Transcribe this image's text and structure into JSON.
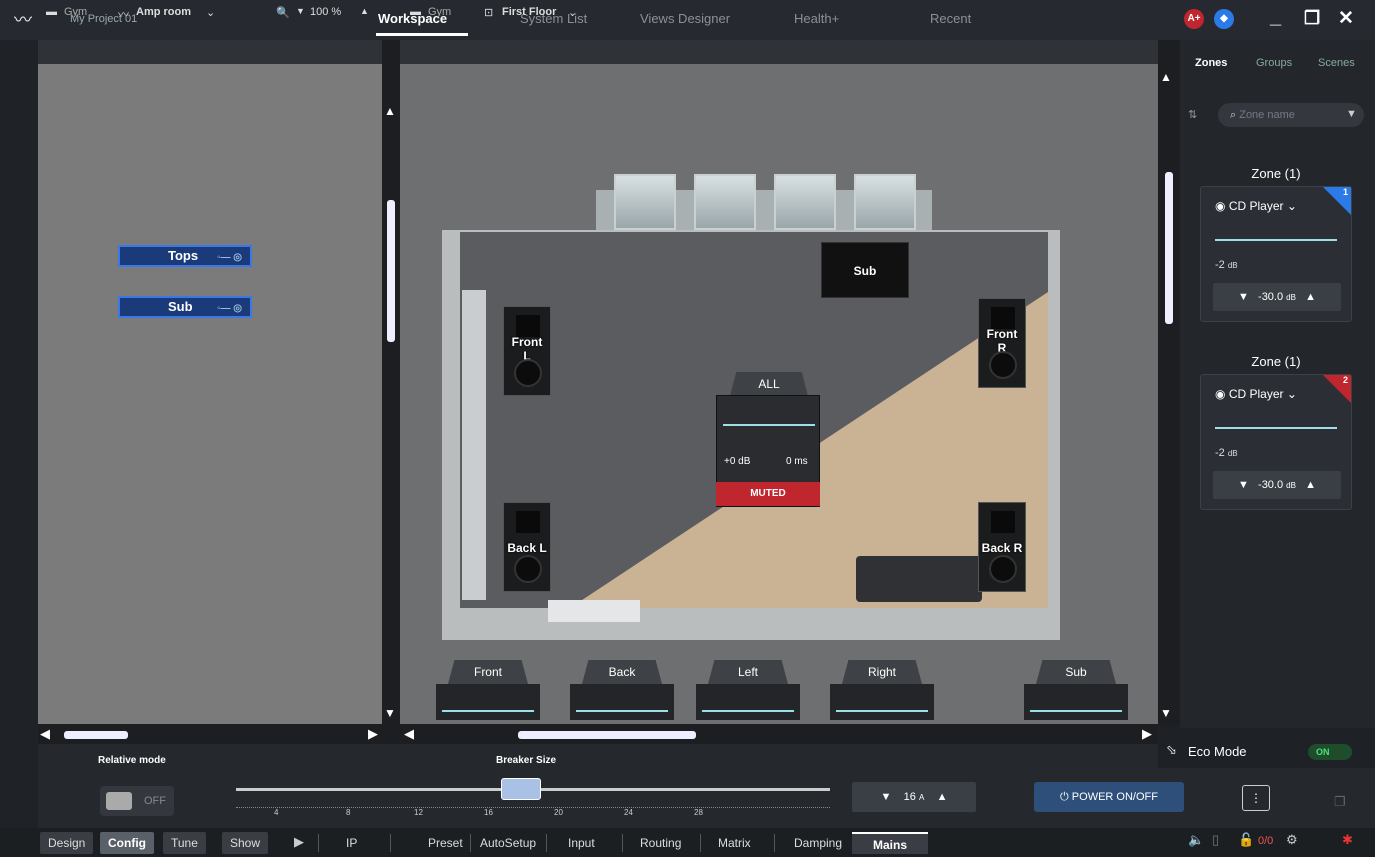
{
  "topbar": {
    "project": "My Project 01",
    "tabs": [
      "Workspace",
      "System List",
      "Views Designer",
      "Health+",
      "Recent"
    ],
    "active_tab": "Workspace",
    "badge_a": "A+",
    "badge_b": "◆",
    "minimize": "_",
    "restore": "❐",
    "close": "✕"
  },
  "left_panel": {
    "crumb_root": "Gym",
    "crumb_view": "Amp room",
    "zoom": "100 %",
    "amps": [
      {
        "label": "Tops"
      },
      {
        "label": "Sub"
      }
    ]
  },
  "floor_panel": {
    "crumb_root": "Gym",
    "crumb_view": "First Floor",
    "speakers": {
      "front_l": "Front\nL",
      "front_r": "Front\nR",
      "back_l": "Back L",
      "back_r": "Back R",
      "sub": "Sub"
    },
    "all": {
      "title": "ALL",
      "gain": "+0 dB",
      "delay": "0 ms",
      "muted": "MUTED"
    },
    "groups": [
      "Front",
      "Back",
      "Left",
      "Right",
      "Sub"
    ]
  },
  "right_panel": {
    "tabs": [
      "Zones",
      "Groups",
      "Scenes"
    ],
    "active": "Zones",
    "search_placeholder": "Zone name",
    "zones": [
      {
        "title": "Zone (1)",
        "source": "CD Player",
        "level": "-2",
        "level_unit": "dB",
        "step": "-30.0",
        "step_unit": "dB",
        "number": "1",
        "color": "#2a7ae8"
      },
      {
        "title": "Zone (1)",
        "source": "CD Player",
        "level": "-2",
        "level_unit": "dB",
        "step": "-30.0",
        "step_unit": "dB",
        "number": "2",
        "color": "#c0262d"
      }
    ]
  },
  "eco": {
    "label": "Eco Mode",
    "state": "ON"
  },
  "bottom": {
    "relative_label": "Relative mode",
    "relative_state": "OFF",
    "breaker_label": "Breaker Size",
    "breaker_value": "16",
    "breaker_unit": "A",
    "breaker_fraction": 0.48,
    "ticks": [
      "4",
      "8",
      "12",
      "16",
      "20",
      "24",
      "28"
    ],
    "power": "POWER ON/OFF",
    "more": "⋮"
  },
  "tabbar": {
    "modes": [
      "Design",
      "Config",
      "Tune",
      "Show"
    ],
    "active_mode": "Config",
    "tabs": [
      "IP",
      "Preset",
      "AutoSetup",
      "Input",
      "Routing",
      "Matrix",
      "Damping",
      "Mains"
    ],
    "active_tab": "Mains",
    "counter": "0/0"
  }
}
